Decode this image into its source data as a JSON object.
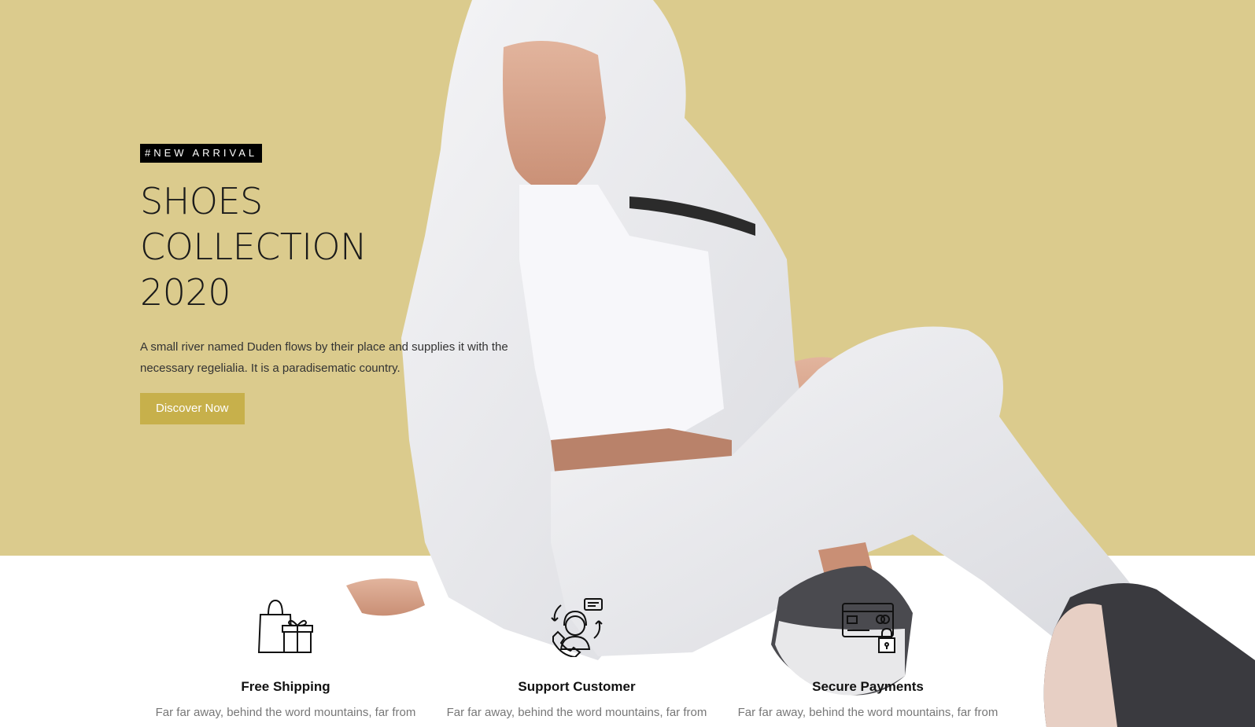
{
  "hero": {
    "tag": "#NEW ARRIVAL",
    "title_line1": "SHOES COLLECTION",
    "title_line2": "2020",
    "description": "A small river named Duden flows by their place and supplies it with the necessary regelialia. It is a paradisematic country.",
    "cta_label": "Discover Now",
    "background_color": "#dbcb8d",
    "accent_color": "#c7b04b"
  },
  "features": [
    {
      "icon": "shopping-bag-gift-icon",
      "title": "Free Shipping",
      "text": "Far far away, behind the word mountains, far from"
    },
    {
      "icon": "customer-support-icon",
      "title": "Support Customer",
      "text": "Far far away, behind the word mountains, far from"
    },
    {
      "icon": "secure-payment-card-icon",
      "title": "Secure Payments",
      "text": "Far far away, behind the word mountains, far from"
    }
  ]
}
